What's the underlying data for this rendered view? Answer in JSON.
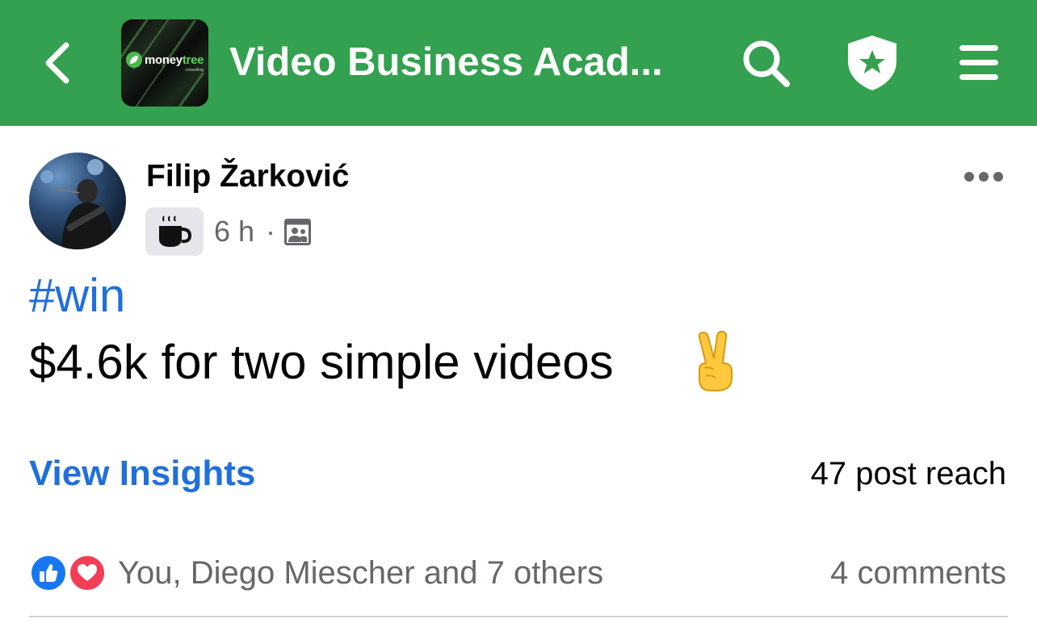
{
  "header": {
    "background_color": "#33a14f",
    "title": "Video Business Acad...",
    "back_icon": "chevron-left-icon",
    "logo": {
      "brand_word_1": "money",
      "brand_word_2": "tree",
      "brand_sub": "consulting"
    },
    "search_icon": "search-icon",
    "admin_icon": "shield-star-icon",
    "menu_icon": "hamburger-menu-icon"
  },
  "post": {
    "author": "Filip Žarković",
    "badge_icon": "coffee-cup-icon",
    "time": "6 h",
    "separator": "·",
    "audience_icon": "group-members-icon",
    "more_icon": "ellipsis-icon",
    "hashtag": "#win",
    "text": "$4.6k for two simple videos",
    "emoji": "✌️",
    "link_color": "#216fdb"
  },
  "insights": {
    "label": "View Insights",
    "reach": "47 post reach"
  },
  "engagement": {
    "reactions": [
      "like",
      "love"
    ],
    "reactors": "You, Diego Miescher and 7 others",
    "comments": "4 comments"
  }
}
